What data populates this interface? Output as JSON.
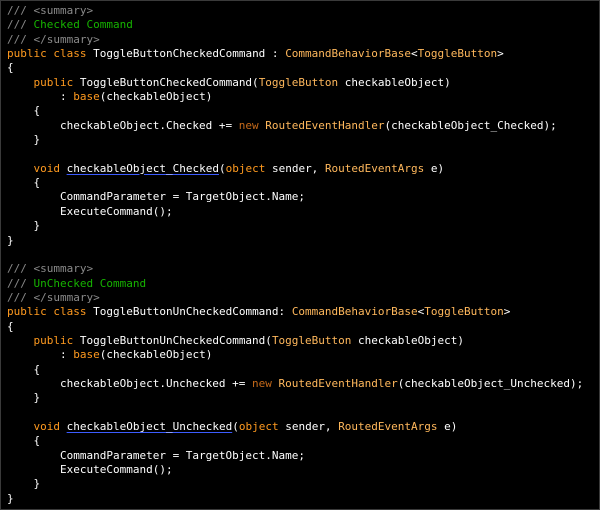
{
  "editor": {
    "theme_colors": {
      "background": "#000000",
      "keyword": "#ff9a1f",
      "type_name": "#ffb85c",
      "plain_text": "#ffffff",
      "comment_marker": "#8a8a8a",
      "comment_text": "#16b300",
      "squiggle_underline": "#3c5cff"
    },
    "lines": [
      {
        "tokens": [
          {
            "t": "/// ",
            "c": "cm"
          },
          {
            "t": "<summary>",
            "c": "cm"
          }
        ]
      },
      {
        "tokens": [
          {
            "t": "/// ",
            "c": "cm"
          },
          {
            "t": "Checked Command",
            "c": "cmg"
          }
        ]
      },
      {
        "tokens": [
          {
            "t": "/// ",
            "c": "cm"
          },
          {
            "t": "</summary>",
            "c": "cm"
          }
        ]
      },
      {
        "tokens": [
          {
            "t": "public",
            "c": "kw"
          },
          {
            "t": " ",
            "c": "pl"
          },
          {
            "t": "class",
            "c": "kw"
          },
          {
            "t": " ToggleButtonCheckedCommand : ",
            "c": "pl"
          },
          {
            "t": "CommandBehaviorBase",
            "c": "cls"
          },
          {
            "t": "<",
            "c": "pl"
          },
          {
            "t": "ToggleButton",
            "c": "cls"
          },
          {
            "t": ">",
            "c": "pl"
          }
        ]
      },
      {
        "tokens": [
          {
            "t": "{",
            "c": "pl"
          }
        ]
      },
      {
        "tokens": [
          {
            "t": "    ",
            "c": "pl"
          },
          {
            "t": "public",
            "c": "kw"
          },
          {
            "t": " ToggleButtonCheckedCommand(",
            "c": "pl"
          },
          {
            "t": "ToggleButton",
            "c": "cls"
          },
          {
            "t": " checkableObject)",
            "c": "pl"
          }
        ]
      },
      {
        "tokens": [
          {
            "t": "        : ",
            "c": "pl"
          },
          {
            "t": "base",
            "c": "kw"
          },
          {
            "t": "(checkableObject)",
            "c": "pl"
          }
        ]
      },
      {
        "tokens": [
          {
            "t": "    {",
            "c": "pl"
          }
        ]
      },
      {
        "tokens": [
          {
            "t": "        checkableObject.Checked += ",
            "c": "pl"
          },
          {
            "t": "new",
            "c": "kw2"
          },
          {
            "t": " ",
            "c": "pl"
          },
          {
            "t": "RoutedEventHandler",
            "c": "cls"
          },
          {
            "t": "(checkableObject_Checked);",
            "c": "pl"
          }
        ]
      },
      {
        "tokens": [
          {
            "t": "    }",
            "c": "pl"
          }
        ]
      },
      {
        "tokens": [
          {
            "t": "",
            "c": "pl"
          }
        ]
      },
      {
        "tokens": [
          {
            "t": "    ",
            "c": "pl"
          },
          {
            "t": "void",
            "c": "kw"
          },
          {
            "t": " ",
            "c": "pl"
          },
          {
            "t": "checkableObject_Checked",
            "c": "pl",
            "u": true
          },
          {
            "t": "(",
            "c": "pl"
          },
          {
            "t": "object",
            "c": "kw"
          },
          {
            "t": " sender, ",
            "c": "pl"
          },
          {
            "t": "RoutedEventArgs",
            "c": "cls"
          },
          {
            "t": " e)",
            "c": "pl"
          }
        ]
      },
      {
        "tokens": [
          {
            "t": "    {",
            "c": "pl"
          }
        ]
      },
      {
        "tokens": [
          {
            "t": "        CommandParameter = TargetObject.Name;",
            "c": "pl"
          }
        ]
      },
      {
        "tokens": [
          {
            "t": "        ExecuteCommand();",
            "c": "pl"
          }
        ]
      },
      {
        "tokens": [
          {
            "t": "    }",
            "c": "pl"
          }
        ]
      },
      {
        "tokens": [
          {
            "t": "}",
            "c": "pl"
          }
        ]
      },
      {
        "tokens": [
          {
            "t": "",
            "c": "pl"
          }
        ]
      },
      {
        "tokens": [
          {
            "t": "/// ",
            "c": "cm"
          },
          {
            "t": "<summary>",
            "c": "cm"
          }
        ]
      },
      {
        "tokens": [
          {
            "t": "/// ",
            "c": "cm"
          },
          {
            "t": "UnChecked Command",
            "c": "cmg"
          }
        ]
      },
      {
        "tokens": [
          {
            "t": "/// ",
            "c": "cm"
          },
          {
            "t": "</summary>",
            "c": "cm"
          }
        ]
      },
      {
        "tokens": [
          {
            "t": "public",
            "c": "kw"
          },
          {
            "t": " ",
            "c": "pl"
          },
          {
            "t": "class",
            "c": "kw"
          },
          {
            "t": " ToggleButtonUnCheckedCommand: ",
            "c": "pl"
          },
          {
            "t": "CommandBehaviorBase",
            "c": "cls"
          },
          {
            "t": "<",
            "c": "pl"
          },
          {
            "t": "ToggleButton",
            "c": "cls"
          },
          {
            "t": ">",
            "c": "pl"
          }
        ]
      },
      {
        "tokens": [
          {
            "t": "{",
            "c": "pl"
          }
        ]
      },
      {
        "tokens": [
          {
            "t": "    ",
            "c": "pl"
          },
          {
            "t": "public",
            "c": "kw"
          },
          {
            "t": " ToggleButtonUnCheckedCommand(",
            "c": "pl"
          },
          {
            "t": "ToggleButton",
            "c": "cls"
          },
          {
            "t": " checkableObject)",
            "c": "pl"
          }
        ]
      },
      {
        "tokens": [
          {
            "t": "        : ",
            "c": "pl"
          },
          {
            "t": "base",
            "c": "kw"
          },
          {
            "t": "(checkableObject)",
            "c": "pl"
          }
        ]
      },
      {
        "tokens": [
          {
            "t": "    {",
            "c": "pl"
          }
        ]
      },
      {
        "tokens": [
          {
            "t": "        checkableObject.Unchecked += ",
            "c": "pl"
          },
          {
            "t": "new",
            "c": "kw2"
          },
          {
            "t": " ",
            "c": "pl"
          },
          {
            "t": "RoutedEventHandler",
            "c": "cls"
          },
          {
            "t": "(checkableObject_Unchecked);",
            "c": "pl"
          }
        ]
      },
      {
        "tokens": [
          {
            "t": "    }",
            "c": "pl"
          }
        ]
      },
      {
        "tokens": [
          {
            "t": "",
            "c": "pl"
          }
        ]
      },
      {
        "tokens": [
          {
            "t": "    ",
            "c": "pl"
          },
          {
            "t": "void",
            "c": "kw"
          },
          {
            "t": " ",
            "c": "pl"
          },
          {
            "t": "checkableObject_Unchecked",
            "c": "pl",
            "u": true
          },
          {
            "t": "(",
            "c": "pl"
          },
          {
            "t": "object",
            "c": "kw"
          },
          {
            "t": " sender, ",
            "c": "pl"
          },
          {
            "t": "RoutedEventArgs",
            "c": "cls"
          },
          {
            "t": " e)",
            "c": "pl"
          }
        ]
      },
      {
        "tokens": [
          {
            "t": "    {",
            "c": "pl"
          }
        ]
      },
      {
        "tokens": [
          {
            "t": "        CommandParameter = TargetObject.Name;",
            "c": "pl"
          }
        ]
      },
      {
        "tokens": [
          {
            "t": "        ExecuteCommand();",
            "c": "pl"
          }
        ]
      },
      {
        "tokens": [
          {
            "t": "    }",
            "c": "pl"
          }
        ]
      },
      {
        "tokens": [
          {
            "t": "}",
            "c": "pl"
          }
        ]
      }
    ]
  }
}
